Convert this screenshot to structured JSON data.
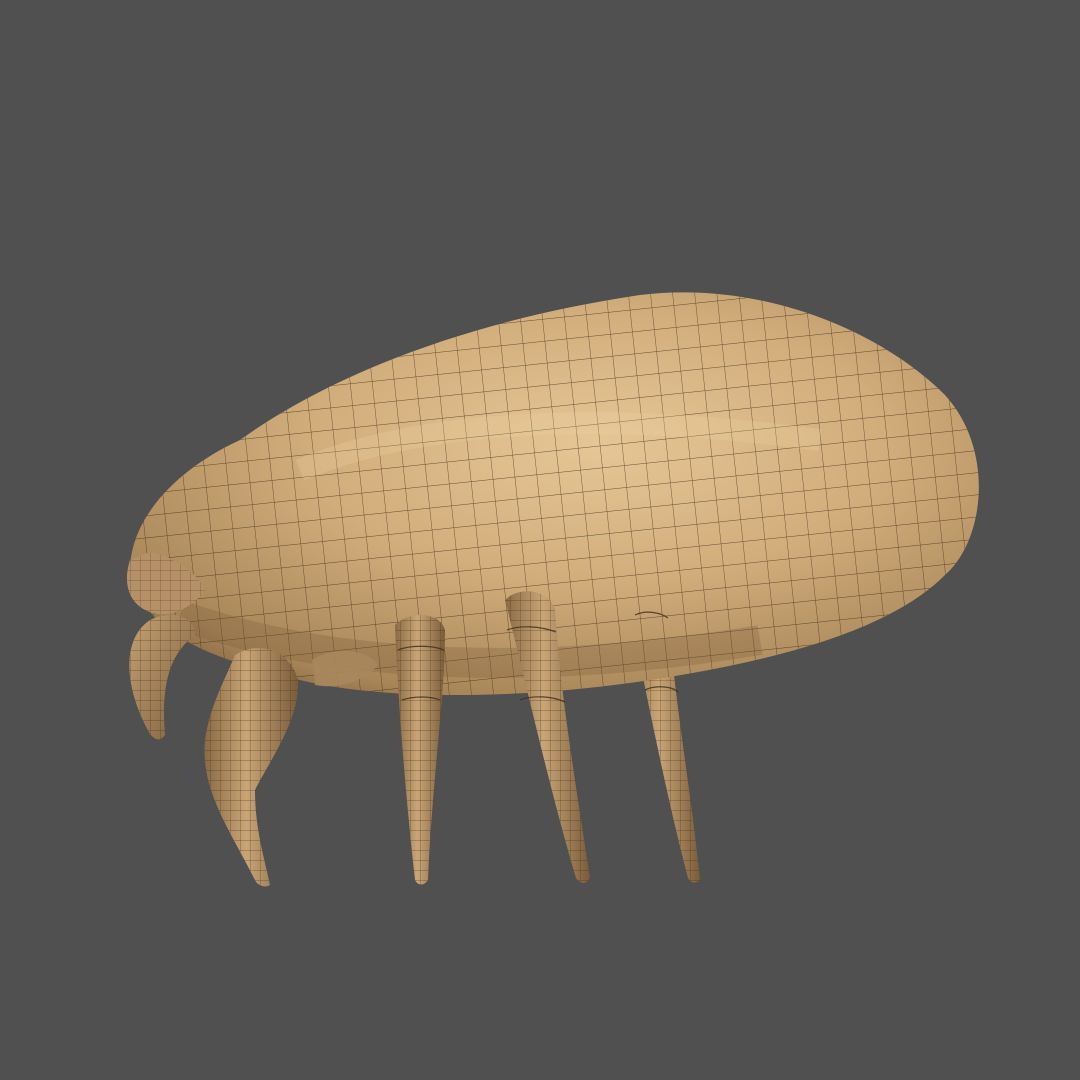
{
  "viewport": {
    "background": "#505050"
  },
  "model": {
    "subject": "mite",
    "render_style": "clay-shaded-with-wireframe",
    "base_color": "#c9a576",
    "highlight_color": "#e3c192",
    "shadow_color": "#8d6d48",
    "wire_color": "#3a2a18",
    "leg_count": 5,
    "has_front_claw": true
  }
}
